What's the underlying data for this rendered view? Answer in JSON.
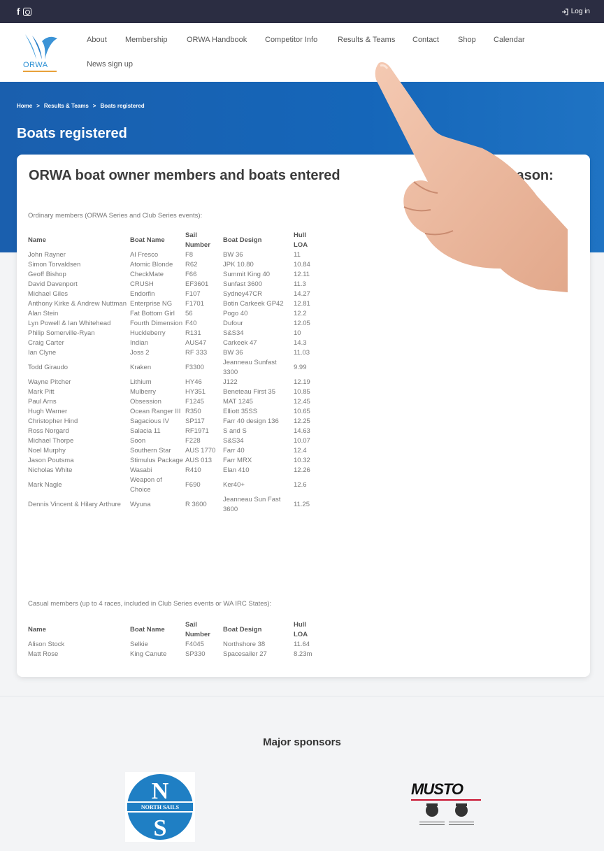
{
  "topbar": {
    "facebook_glyph": "f",
    "login_label": "Log in",
    "icons": [
      "facebook-icon",
      "instagram-icon",
      "login-icon"
    ]
  },
  "logo": {
    "wordmark": "ORWA"
  },
  "nav": {
    "items": [
      "About",
      "Membership",
      "ORWA Handbook",
      "Competitor Info",
      "Results & Teams",
      "Contact",
      "Shop",
      "Calendar",
      "News sign up"
    ]
  },
  "breadcrumb": {
    "home": "Home",
    "section": "Results & Teams",
    "current": "Boats registered",
    "separator": ">"
  },
  "page_title": "Boats registered",
  "card": {
    "title": "ORWA boat owner members and boats entered",
    "title_end": "Season:",
    "ordinary_label": "Ordinary members (ORWA Series and Club Series events):",
    "casual_label": "Casual members (up to 4 races, included in Club Series events or WA IRC States):"
  },
  "table_headers": [
    "Name",
    "Boat Name",
    "Sail Number",
    "Boat Design",
    "Hull LOA"
  ],
  "ordinary_rows": [
    [
      "John Rayner",
      "Al Fresco",
      "F8",
      "BW 36",
      "11"
    ],
    [
      "Simon Torvaldsen",
      "Atomic Blonde",
      "R62",
      "JPK 10.80",
      "10.84"
    ],
    [
      "Geoff Bishop",
      "CheckMate",
      "F66",
      "Summit King 40",
      "12.11"
    ],
    [
      "David Davenport",
      "CRUSH",
      "EF3601",
      "Sunfast 3600",
      "11.3"
    ],
    [
      "Michael Giles",
      "Endorfin",
      "F107",
      "Sydney47CR",
      "14.27"
    ],
    [
      "Anthony Kirke & Andrew Nuttman",
      "Enterprise NG",
      "F1701",
      "Botin Carkeek GP42",
      "12.81"
    ],
    [
      "Alan Stein",
      "Fat Bottom Girl",
      "56",
      "Pogo 40",
      "12.2"
    ],
    [
      "Lyn Powell & Ian Whitehead",
      "Fourth Dimension",
      "F40",
      "Dufour",
      "12.05"
    ],
    [
      "Philip Somerville-Ryan",
      "Huckleberry",
      "R131",
      "S&S34",
      "10"
    ],
    [
      "Craig Carter",
      "Indian",
      "AUS47",
      "Carkeek 47",
      "14.3"
    ],
    [
      "Ian Clyne",
      "Joss 2",
      "RF 333",
      "BW 36",
      "11.03"
    ],
    [
      "Todd Giraudo",
      "Kraken",
      "F3300",
      "Jeanneau Sunfast 3300",
      "9.99"
    ],
    [
      "Wayne Pitcher",
      "Lithium",
      "HY46",
      "J122",
      "12.19"
    ],
    [
      "Mark Pitt",
      "Mulberry",
      "HY351",
      "Beneteau First 35",
      "10.85"
    ],
    [
      "Paul Arns",
      "Obsession",
      "F1245",
      "MAT 1245",
      "12.45"
    ],
    [
      "Hugh Warner",
      "Ocean Ranger III",
      "R350",
      "Elliott 35SS",
      "10.65"
    ],
    [
      "Christopher Hind",
      "Sagacious IV",
      "SP117",
      "Farr 40 design 136",
      "12.25"
    ],
    [
      "Ross Norgard",
      "Salacia 11",
      "RF1971",
      "S and S",
      "14.63"
    ],
    [
      "Michael Thorpe",
      "Soon",
      "F228",
      "S&S34",
      "10.07"
    ],
    [
      "Noel Murphy",
      "Southern Star",
      "AUS 1770",
      "Farr 40",
      "12.4"
    ],
    [
      "Jason Poutsma",
      "Stimulus Package",
      "AUS 013",
      "Farr MRX",
      "10.32"
    ],
    [
      "Nicholas White",
      "Wasabi",
      "R410",
      "Elan 410",
      "12.26"
    ],
    [
      "Mark Nagle",
      "Weapon of Choice",
      "F690",
      "Ker40+",
      "12.6"
    ],
    [
      "Dennis Vincent & Hilary Arthure",
      "Wyuna",
      "R 3600",
      "Jeanneau Sun Fast 3600",
      "11.25"
    ]
  ],
  "casual_rows": [
    [
      "Alison Stock",
      "Selkie",
      "F4045",
      "Northshore 38",
      "11.64"
    ],
    [
      "Matt Rose",
      "King Canute",
      "SP330",
      "Spacesailer 27",
      "8.23m"
    ]
  ],
  "sponsors": {
    "title": "Major sponsors",
    "north_sails": {
      "letter_top": "N",
      "band_text": "NORTH SAILS",
      "letter_bottom": "S"
    },
    "musto": {
      "wordmark": "MUSTO"
    }
  },
  "colors": {
    "topbar": "#2b2d42",
    "hero_blue": "#1566b9",
    "logo_blue": "#2a8fd4",
    "north_sails_blue": "#1f7fc4",
    "musto_red": "#c8102e"
  }
}
